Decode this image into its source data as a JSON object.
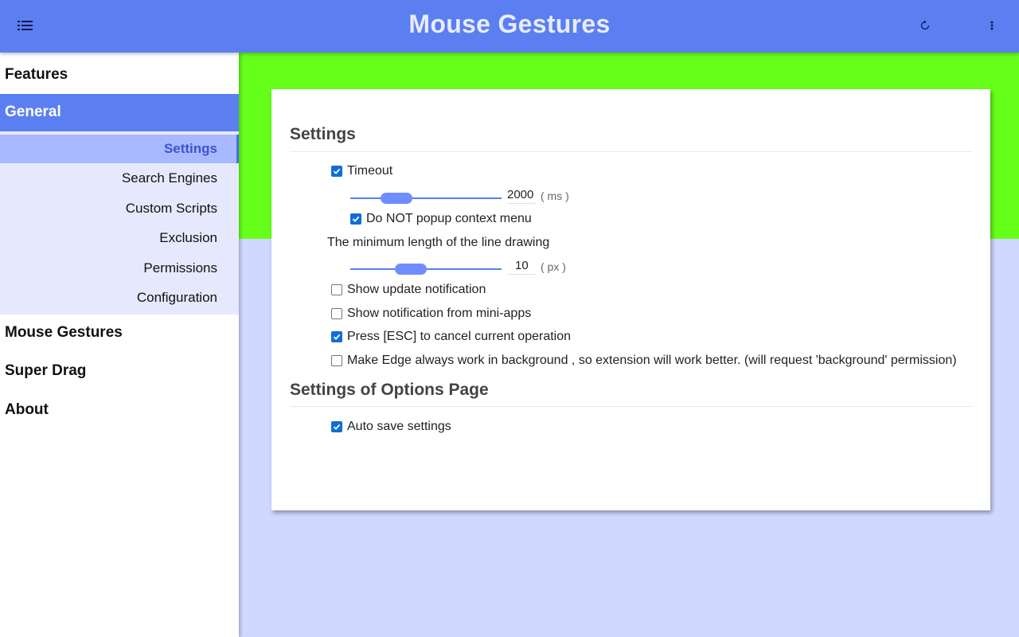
{
  "header": {
    "title": "Mouse Gestures",
    "menu_icon": "menu-icon",
    "reload_icon": "reload-icon",
    "more_icon": "more-vert-icon",
    "bg_color": "#5b7ff1"
  },
  "sidebar": {
    "features": "Features",
    "general": "General",
    "general_sub": [
      {
        "label": "Settings",
        "active": true
      },
      {
        "label": "Search Engines"
      },
      {
        "label": "Custom Scripts"
      },
      {
        "label": "Exclusion"
      },
      {
        "label": "Permissions"
      },
      {
        "label": "Configuration"
      }
    ],
    "items": [
      "Mouse Gestures",
      "Super Drag",
      "About"
    ]
  },
  "settings": {
    "title": "Settings",
    "timeout": {
      "label": "Timeout",
      "checked": true,
      "value": "2000",
      "unit": "( ms )",
      "slider_fraction": 0.25
    },
    "no_popup": {
      "label": "Do NOT popup context menu",
      "checked": true
    },
    "min_length": {
      "label": "The minimum length of the line drawing",
      "value": "10",
      "unit": "( px )",
      "slider_fraction": 0.37
    },
    "update_notification": {
      "label": "Show update notification",
      "checked": false
    },
    "mini_apps_notification": {
      "label": "Show notification from mini-apps",
      "checked": false
    },
    "press_esc": {
      "label": "Press [ESC] to cancel current operation",
      "checked": true
    },
    "background": {
      "label": "Make Edge always work in background , so extension will work better. (will request 'background' permission)",
      "checked": false
    }
  },
  "options_page": {
    "title": "Settings of Options Page",
    "auto_save": {
      "label": "Auto save settings",
      "checked": true
    }
  },
  "colors": {
    "accent": "#5b7ff1",
    "green_band": "#66ff19",
    "page_bg": "#d0d8ff",
    "checkbox": "#0f6fd6"
  }
}
